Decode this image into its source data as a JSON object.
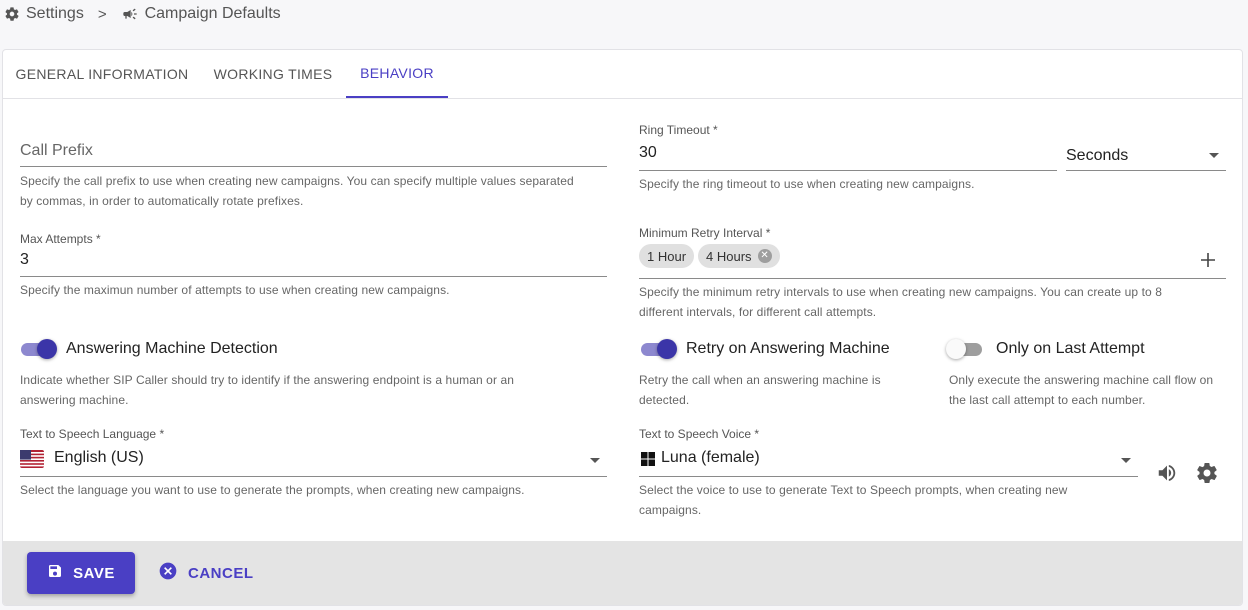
{
  "breadcrumb": {
    "settings_label": "Settings",
    "separator": ">",
    "campaign_label": "Campaign Defaults"
  },
  "tabs": [
    {
      "label": "GENERAL INFORMATION",
      "active": false
    },
    {
      "label": "WORKING TIMES",
      "active": false
    },
    {
      "label": "BEHAVIOR",
      "active": true
    }
  ],
  "call_prefix": {
    "placeholder": "Call Prefix",
    "value": "",
    "helper_line1": "Specify the call prefix to use when creating new campaigns. You can specify multiple values separated",
    "helper_line2": "by commas, in order to automatically rotate prefixes."
  },
  "ring_timeout": {
    "label": "Ring Timeout *",
    "value": "30",
    "unit": "Seconds",
    "helper": "Specify the ring timeout to use when creating new campaigns."
  },
  "max_attempts": {
    "label": "Max Attempts *",
    "value": "3",
    "helper": "Specify the maximun number of attempts to use when creating new campaigns."
  },
  "min_retry_interval": {
    "label": "Minimum Retry Interval *",
    "chips": [
      "1 Hour",
      "4 Hours"
    ],
    "add_icon": "plus-icon",
    "helper_line1": "Specify the minimum retry intervals to use when creating new campaigns. You can create up to 8",
    "helper_line2": "different intervals, for different call attempts."
  },
  "amd": {
    "label": "Answering Machine Detection",
    "enabled": true,
    "helper_line1": "Indicate whether SIP Caller should try to identify if the answering endpoint is a human or an",
    "helper_line2": "answering machine."
  },
  "retry_on_am": {
    "label": "Retry on Answering Machine",
    "enabled": true,
    "helper_line1": "Retry the call when an answering machine is",
    "helper_line2": "detected."
  },
  "only_last_attempt": {
    "label": "Only on Last Attempt",
    "enabled": false,
    "helper_line1": "Only execute the answering machine call flow on",
    "helper_line2": "the last call attempt to each number."
  },
  "tts_language": {
    "label": "Text to Speech Language *",
    "value": "English (US)",
    "flag_icon": "us-flag-icon",
    "helper": "Select the language you want to use to generate the prompts, when creating new campaigns."
  },
  "tts_voice": {
    "label": "Text to Speech Voice *",
    "value": "Luna (female)",
    "provider_icon": "windows-icon",
    "helper_line1": "Select the voice to use to generate Text to Speech prompts, when creating new",
    "helper_line2": "campaigns."
  },
  "footer": {
    "save_label": "SAVE",
    "cancel_label": "CANCEL"
  },
  "colors": {
    "accent": "#4a3fc4",
    "switch_on_thumb": "#3b35a8",
    "switch_on_track": "#8d88cf",
    "footer_bg": "#e4e4e4"
  }
}
